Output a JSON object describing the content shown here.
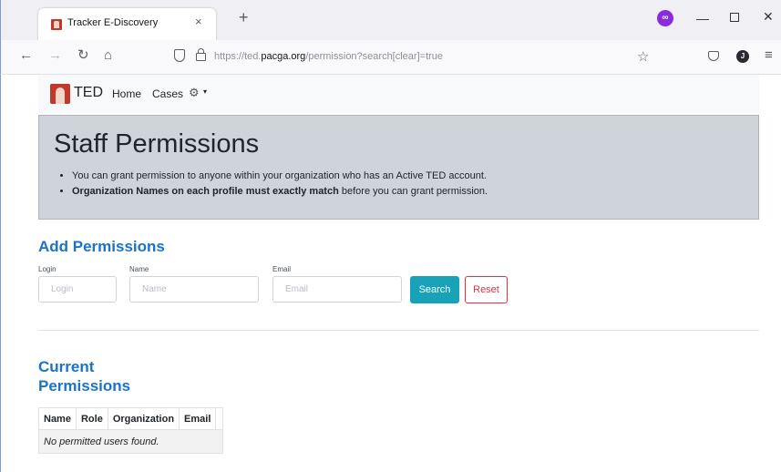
{
  "browser": {
    "tab_title": "Tracker E-Discovery",
    "tab_close": "×",
    "new_tab": "+",
    "url_prefix": "https://ted.",
    "url_domain": "pacga.org",
    "url_path": "/permission?search[clear]=true",
    "profile_initial": "J"
  },
  "app": {
    "brand": "TED",
    "nav": {
      "home": "Home",
      "cases": "Cases",
      "caret": "▾"
    }
  },
  "jumbotron": {
    "title": "Staff Permissions",
    "bullet1": "You can grant permission to anyone within your organization who has an Active TED account.",
    "bullet2_bold": "Organization Names on each profile must exactly match",
    "bullet2_rest": " before you can grant permission."
  },
  "add_permissions": {
    "title": "Add Permissions",
    "login_label": "Login",
    "login_placeholder": "Login",
    "name_label": "Name",
    "name_placeholder": "Name",
    "email_label": "Email",
    "email_placeholder": "Email",
    "search_button": "Search",
    "reset_button": "Reset"
  },
  "current_permissions": {
    "title_line1": "Current",
    "title_line2": "Permissions",
    "columns": [
      "Name",
      "Role",
      "Organization",
      "Email"
    ],
    "empty_message": "No permitted users found."
  }
}
